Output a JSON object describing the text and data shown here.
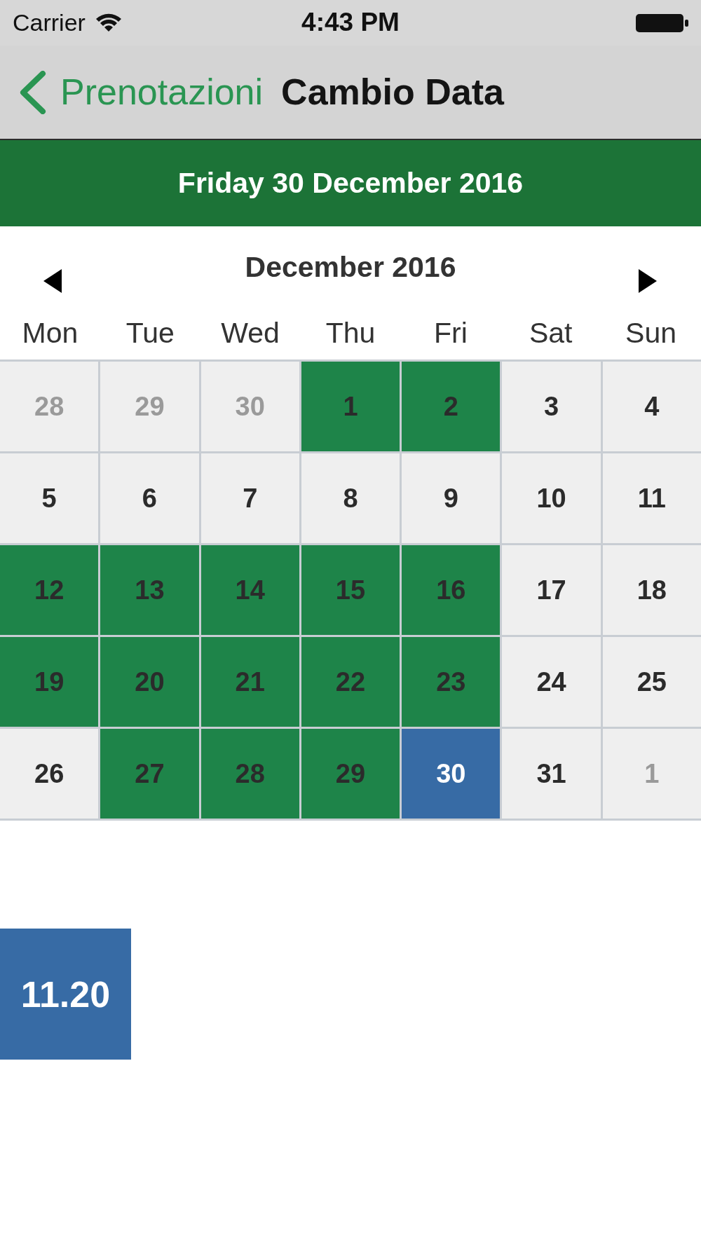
{
  "status_bar": {
    "carrier": "Carrier",
    "time": "4:43 PM"
  },
  "nav_bar": {
    "back_label": "Prenotazioni",
    "title": "Cambio Data"
  },
  "selected_date": "Friday 30 December 2016",
  "calendar": {
    "month_label": "December 2016",
    "weekdays": [
      "Mon",
      "Tue",
      "Wed",
      "Thu",
      "Fri",
      "Sat",
      "Sun"
    ],
    "weeks": [
      [
        {
          "day": "28",
          "in_month": false,
          "available": false,
          "selected": false
        },
        {
          "day": "29",
          "in_month": false,
          "available": false,
          "selected": false
        },
        {
          "day": "30",
          "in_month": false,
          "available": false,
          "selected": false
        },
        {
          "day": "1",
          "in_month": true,
          "available": true,
          "selected": false
        },
        {
          "day": "2",
          "in_month": true,
          "available": true,
          "selected": false
        },
        {
          "day": "3",
          "in_month": true,
          "available": false,
          "selected": false
        },
        {
          "day": "4",
          "in_month": true,
          "available": false,
          "selected": false
        }
      ],
      [
        {
          "day": "5",
          "in_month": true,
          "available": false,
          "selected": false
        },
        {
          "day": "6",
          "in_month": true,
          "available": false,
          "selected": false
        },
        {
          "day": "7",
          "in_month": true,
          "available": false,
          "selected": false
        },
        {
          "day": "8",
          "in_month": true,
          "available": false,
          "selected": false
        },
        {
          "day": "9",
          "in_month": true,
          "available": false,
          "selected": false
        },
        {
          "day": "10",
          "in_month": true,
          "available": false,
          "selected": false
        },
        {
          "day": "11",
          "in_month": true,
          "available": false,
          "selected": false
        }
      ],
      [
        {
          "day": "12",
          "in_month": true,
          "available": true,
          "selected": false
        },
        {
          "day": "13",
          "in_month": true,
          "available": true,
          "selected": false
        },
        {
          "day": "14",
          "in_month": true,
          "available": true,
          "selected": false
        },
        {
          "day": "15",
          "in_month": true,
          "available": true,
          "selected": false
        },
        {
          "day": "16",
          "in_month": true,
          "available": true,
          "selected": false
        },
        {
          "day": "17",
          "in_month": true,
          "available": false,
          "selected": false
        },
        {
          "day": "18",
          "in_month": true,
          "available": false,
          "selected": false
        }
      ],
      [
        {
          "day": "19",
          "in_month": true,
          "available": true,
          "selected": false
        },
        {
          "day": "20",
          "in_month": true,
          "available": true,
          "selected": false
        },
        {
          "day": "21",
          "in_month": true,
          "available": true,
          "selected": false
        },
        {
          "day": "22",
          "in_month": true,
          "available": true,
          "selected": false
        },
        {
          "day": "23",
          "in_month": true,
          "available": true,
          "selected": false
        },
        {
          "day": "24",
          "in_month": true,
          "available": false,
          "selected": false
        },
        {
          "day": "25",
          "in_month": true,
          "available": false,
          "selected": false
        }
      ],
      [
        {
          "day": "26",
          "in_month": true,
          "available": false,
          "selected": false
        },
        {
          "day": "27",
          "in_month": true,
          "available": true,
          "selected": false
        },
        {
          "day": "28",
          "in_month": true,
          "available": true,
          "selected": false
        },
        {
          "day": "29",
          "in_month": true,
          "available": true,
          "selected": false
        },
        {
          "day": "30",
          "in_month": true,
          "available": false,
          "selected": true
        },
        {
          "day": "31",
          "in_month": true,
          "available": false,
          "selected": false
        },
        {
          "day": "1",
          "in_month": false,
          "available": false,
          "selected": false
        }
      ]
    ]
  },
  "time_slots": [
    {
      "label": "11.20",
      "selected": true
    }
  ]
}
